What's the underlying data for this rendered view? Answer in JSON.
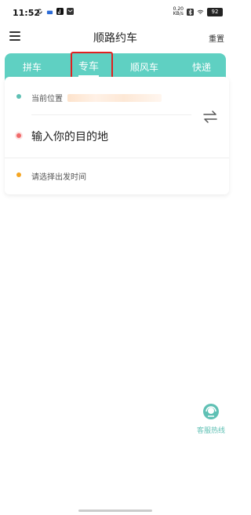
{
  "status_bar": {
    "time": "11:52",
    "net_speed_top": "0.20",
    "net_speed_bottom": "KB/s",
    "battery": "92"
  },
  "nav": {
    "title": "顺路约车",
    "reset_label": "重置"
  },
  "tabs": [
    {
      "label": "拼车",
      "active": false
    },
    {
      "label": "专车",
      "active": true
    },
    {
      "label": "顺风车",
      "active": false
    },
    {
      "label": "快递",
      "active": false
    }
  ],
  "form": {
    "current_location_label": "当前位置",
    "destination_placeholder": "输入你的目的地",
    "departure_time_placeholder": "请选择出发时间"
  },
  "support": {
    "label": "客服热线"
  },
  "colors": {
    "accent": "#5fd0c2",
    "highlight_border": "#e02020",
    "origin_dot": "#5fc0b4",
    "destination_dot": "#f06a6a",
    "time_dot": "#f5a623"
  }
}
